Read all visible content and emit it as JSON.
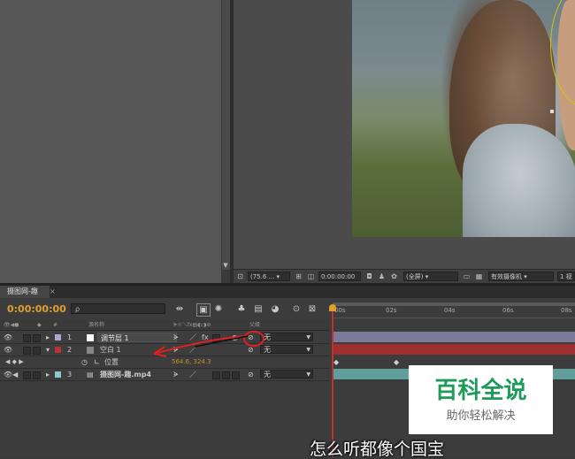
{
  "viewer": {
    "toolbar": {
      "zoom": "(75.6 ...",
      "timecode": "0:00:00:00",
      "resolution": "(全屏)",
      "camera": "有效摄像机",
      "views": "1 视"
    }
  },
  "timeline": {
    "tab_label": "摄图网-趣",
    "current_time": "0:00:00:00",
    "search_placeholder": "ρ",
    "ruler_ticks": [
      "00s",
      "02s",
      "04s",
      "06s",
      "08s"
    ],
    "columns": {
      "source_name": "源名称",
      "parent": "父级"
    },
    "layers": [
      {
        "index": "1",
        "name": "调节层 1",
        "parent": "无",
        "color": "#a9a9d6"
      },
      {
        "index": "2",
        "name": "空白 1",
        "parent": "无",
        "color": "#c03030"
      },
      {
        "index": "3",
        "name": "摄图网-趣.mp4",
        "parent": "无",
        "color": "#8fc9c9"
      }
    ],
    "property": {
      "name": "位置",
      "value": "564.6, 324.3"
    }
  },
  "watermark": {
    "main": "百科全说",
    "sub": "助你轻松解决"
  },
  "subtitle": "怎么听都像个国宝",
  "colors": {
    "timecode": "#e0a030",
    "playhead": "#c03030",
    "adjustment_bar": "#7d7a9a",
    "solid_bar": "#a03030",
    "video_bar": "#5f9e9a",
    "watermark_green": "#1e9a5a"
  }
}
